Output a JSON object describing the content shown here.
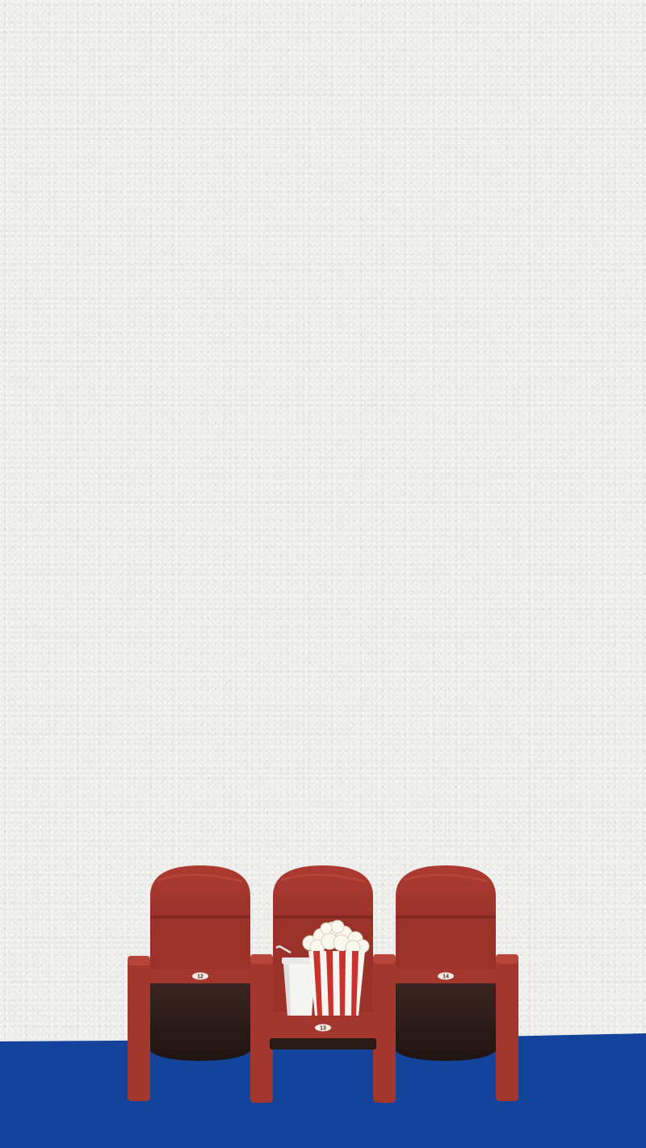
{
  "scene": {
    "colors": {
      "wall": "#ececea",
      "floor": "#13439a",
      "seat": "#a3362d",
      "seat_dark": "#7f2620",
      "cushion": "#2a1a17",
      "cup": "#f2f2f0",
      "popcorn_stripe": "#c8332b"
    }
  },
  "seats": [
    {
      "number": "12"
    },
    {
      "number": "13"
    },
    {
      "number": "14"
    }
  ]
}
